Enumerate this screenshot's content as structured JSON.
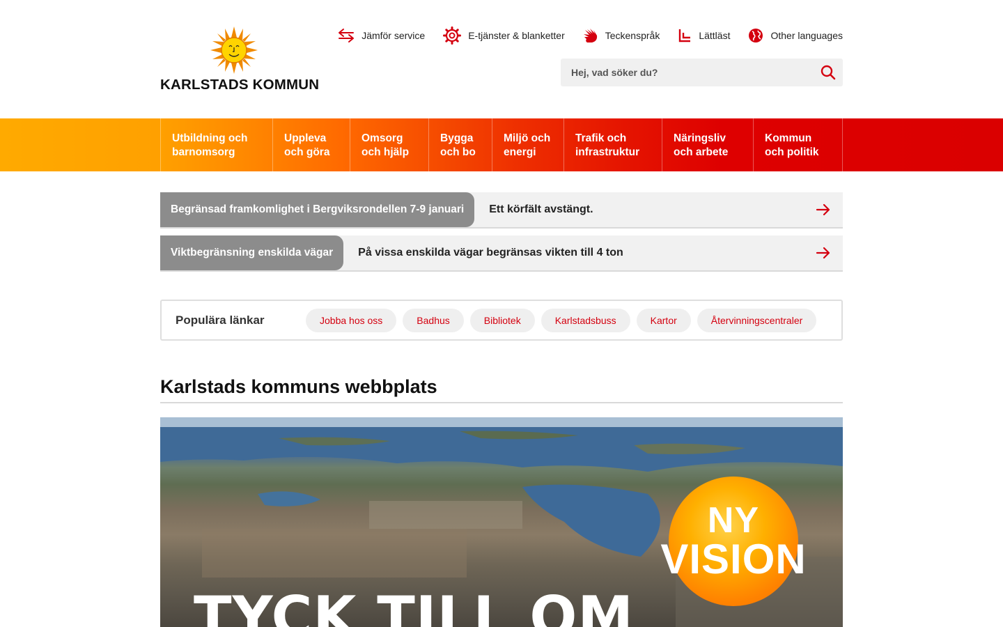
{
  "header": {
    "brand": "KARLSTADS KOMMUN",
    "toplinks": [
      {
        "label": "Jämför service",
        "icon": "compare-arrows-icon"
      },
      {
        "label": "E-tjänster & blanketter",
        "icon": "gear-icon"
      },
      {
        "label": "Teckenspråk",
        "icon": "sign-language-icon"
      },
      {
        "label": "Lättläst",
        "icon": "easy-read-icon"
      },
      {
        "label": "Other languages",
        "icon": "globe-icon"
      }
    ],
    "search": {
      "placeholder": "Hej, vad söker du?",
      "icon": "search-icon"
    }
  },
  "nav": {
    "items": [
      "Utbildning och\nbarnomsorg",
      "Uppleva\noch göra",
      "Omsorg\noch hjälp",
      "Bygga\noch bo",
      "Miljö och\nenergi",
      "Trafik och\ninfrastruktur",
      "Näringsliv\noch arbete",
      "Kommun\noch politik"
    ]
  },
  "alerts": [
    {
      "tag": "Begränsad framkomlighet i Bergviksrondellen 7-9 januari",
      "message": "Ett körfält avstängt."
    },
    {
      "tag": "Viktbegränsning enskilda vägar",
      "message": "På vissa enskilda vägar begränsas vikten till 4 ton"
    }
  ],
  "popular": {
    "title": "Populära länkar",
    "links": [
      "Jobba hos oss",
      "Badhus",
      "Bibliotek",
      "Karlstadsbuss",
      "Kartor",
      "Återvinningscentraler"
    ]
  },
  "main": {
    "title": "Karlstads kommuns webbplats",
    "hero": {
      "badge_line1": "NY",
      "badge_line2": "VISION",
      "headline": "TYCK TILL OM"
    }
  },
  "colors": {
    "accent": "#d4000f",
    "nav_start": "#ffaa00",
    "nav_end": "#da0000"
  }
}
